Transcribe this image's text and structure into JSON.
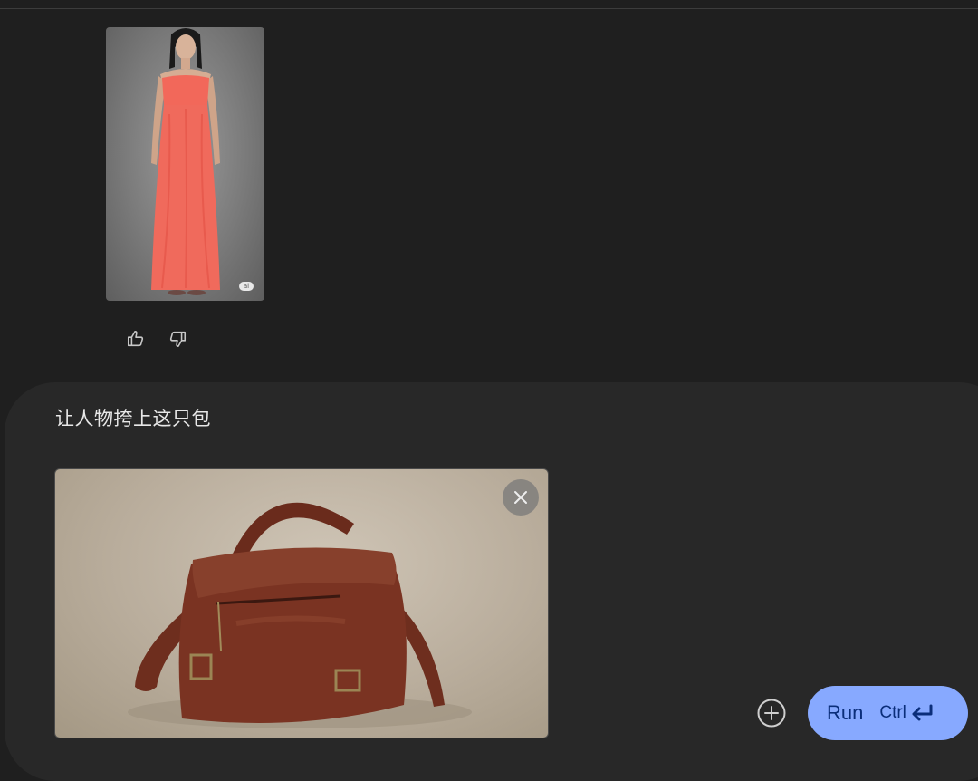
{
  "conversation": {
    "generated_image": {
      "badge": "ai",
      "icon": "generated-dress-image"
    },
    "feedback": {
      "thumb_up_icon": "thumb-up-icon",
      "thumb_down_icon": "thumb-down-icon"
    }
  },
  "composer": {
    "prompt": "让人物挎上这只包",
    "attachment": {
      "icon": "handbag-image",
      "remove_icon": "close-icon"
    },
    "add_icon": "add-circle-icon",
    "run_button": {
      "label": "Run",
      "shortcut": "Ctrl",
      "shortcut_icon": "enter-key-icon",
      "color": "#87a9ff"
    }
  },
  "colors": {
    "background": "#1f1f1f",
    "composer_background": "#282828",
    "dress": "#f2685a"
  }
}
